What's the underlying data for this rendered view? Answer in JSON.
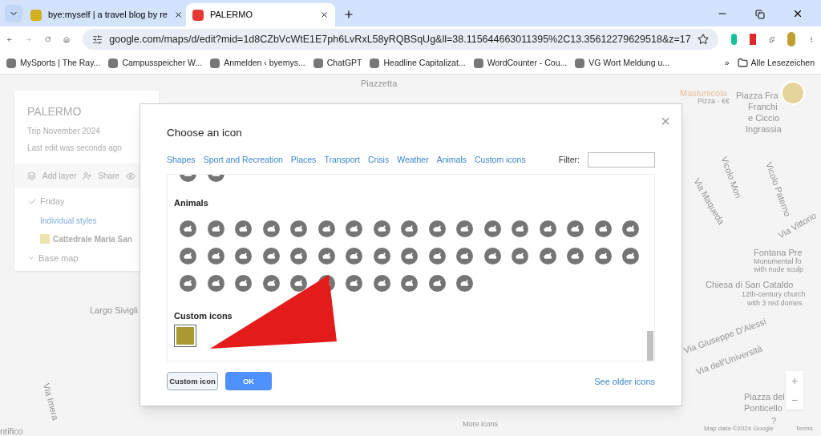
{
  "browser": {
    "tabs": [
      {
        "title": "bye:myself | a travel blog by re",
        "selected": false
      },
      {
        "title": "PALERMO",
        "selected": true
      }
    ],
    "url": "google.com/maps/d/edit?mid=1d8CZbVcWtE1E7ph6LvRxL58yRQBSqUg&ll=38.115644663011395%2C13.35612279629518&z=17",
    "bookmarks": [
      "MySports | The Ray...",
      "Campusspeicher W...",
      "Anmelden ‹ byemys...",
      "ChatGPT",
      "Headline Capitalizat...",
      "WordCounter - Cou...",
      "VG Wort Meldung u..."
    ],
    "more_bookmarks": "»",
    "all_bookmarks": "Alle Lesezeichen"
  },
  "map_labels": [
    "Piazzetta",
    "Mastunicola",
    "Pizza · €€",
    "Piazza Fra",
    "Franchi",
    "e Ciccio",
    "Ingrassia",
    "Via Maqueda",
    "Vicolo Mori",
    "Vicolo Paterno",
    "Via Vittorio",
    "Fontana Pre",
    "Monumental fo",
    "with nude sculp",
    "Chiesa di San Cataldo",
    "12th-century church",
    "with 3 red domes",
    "Via Giuseppe D'Alessi",
    "Via dell'Università",
    "Piazza del",
    "Ponticello",
    "Largo Sivigli",
    "Via Imera",
    "ntifico",
    "More icons",
    "Map data ©2024 Google",
    "Terms",
    "?"
  ],
  "map_panel": {
    "title": "PALERMO",
    "subtitle": "Trip November 2024",
    "last_edit": "Last edit was seconds ago",
    "actions": [
      "Add layer",
      "Share"
    ],
    "layer": {
      "name": "Friday",
      "checked": true,
      "style": "Individual styles",
      "place": "Cattedrale Maria San"
    },
    "base_map": "Base map"
  },
  "zoom": [
    "+",
    "−"
  ],
  "dialog": {
    "title": "Choose an icon",
    "close": "×",
    "tabs": [
      "Shapes",
      "Sport and Recreation",
      "Places",
      "Transport",
      "Crisis",
      "Weather",
      "Animals",
      "Custom icons"
    ],
    "filter": {
      "label": "Filter:"
    },
    "sections": [
      {
        "title": "Animals"
      },
      {
        "title": "Custom icons"
      }
    ],
    "custom_icon_selected": true,
    "buttons": [
      {
        "label": "Custom icon",
        "kind": "secondary"
      },
      {
        "label": "OK",
        "kind": "primary"
      }
    ],
    "older_link": "See older icons"
  }
}
